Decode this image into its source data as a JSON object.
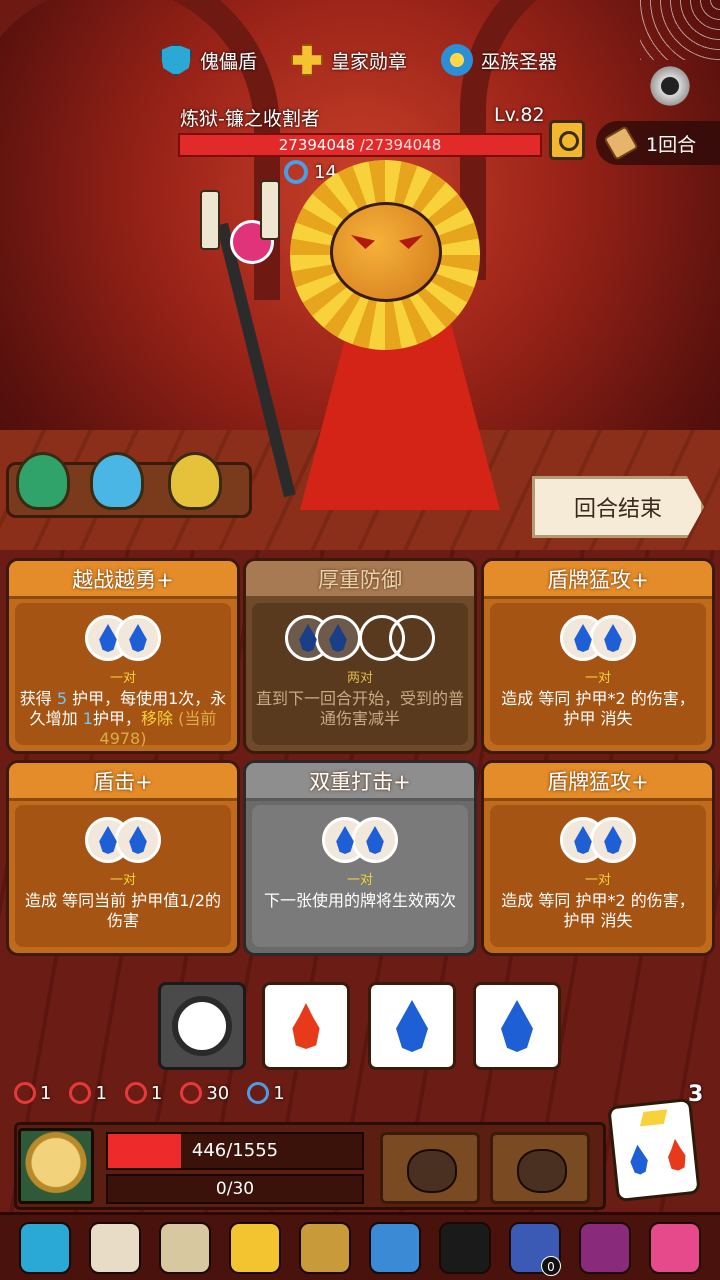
{
  "top_relics": [
    {
      "label": "傀儡盾",
      "icon": "shield-relic-icon"
    },
    {
      "label": "皇家勋章",
      "icon": "medal-relic-icon"
    },
    {
      "label": "巫族圣器",
      "icon": "holy-relic-icon"
    }
  ],
  "enemy": {
    "name": "炼狱-镰之收割者",
    "level": "Lv.82",
    "hp_current": "27394048",
    "hp_max": " /27394048",
    "hp_fraction": 1.0,
    "shield_stat": "14"
  },
  "round": {
    "label": "1回合"
  },
  "end_turn": {
    "label": "回合结束"
  },
  "cards": [
    {
      "title": "越战越勇+",
      "requirement": "一对",
      "desc_parts": [
        "获得 ",
        "5",
        " 护甲，每使用1次，永久增加 ",
        "1",
        "护甲，",
        "移除",
        " (当前4978)"
      ],
      "state": "active"
    },
    {
      "title": "厚重防御",
      "requirement": "两对",
      "desc": "直到下一回合开始，受到的普通伤害减半",
      "state": "disabled"
    },
    {
      "title": "盾牌猛攻+",
      "requirement": "一对",
      "desc": "造成 等同 护甲*2 的伤害， 护甲 消失",
      "state": "active"
    },
    {
      "title": "盾击+",
      "requirement": "一对",
      "desc": "造成 等同当前 护甲值1/2的伤害",
      "state": "active"
    },
    {
      "title": "双重打击+",
      "requirement": "一对",
      "desc": "下一张使用的牌将生效两次",
      "state": "grey"
    },
    {
      "title": "盾牌猛攻+",
      "requirement": "一对",
      "desc": "造成 等同 护甲*2 的伤害， 护甲 消失",
      "state": "active"
    }
  ],
  "dice": [
    {
      "face": "grey-drop",
      "selected": true
    },
    {
      "face": "fire",
      "selected": false
    },
    {
      "face": "water",
      "selected": false
    },
    {
      "face": "water",
      "selected": false
    }
  ],
  "player_stats": [
    {
      "icon": "attack-icon",
      "value": "1"
    },
    {
      "icon": "strength-icon",
      "value": "1"
    },
    {
      "icon": "pierce-icon",
      "value": "1"
    },
    {
      "icon": "burn-icon",
      "value": "30"
    },
    {
      "icon": "ring-icon",
      "value": "1"
    }
  ],
  "player": {
    "hp_text": "446/1555",
    "hp_fraction": 0.287,
    "armor_text": "0/30"
  },
  "dice_remaining": "3",
  "tray_badge": "0",
  "colors": {
    "card_orange": "#e58c2a",
    "water_blue": "#1f5fd6",
    "fire_red": "#e63a1a",
    "hp_red": "#ef2a2a"
  }
}
